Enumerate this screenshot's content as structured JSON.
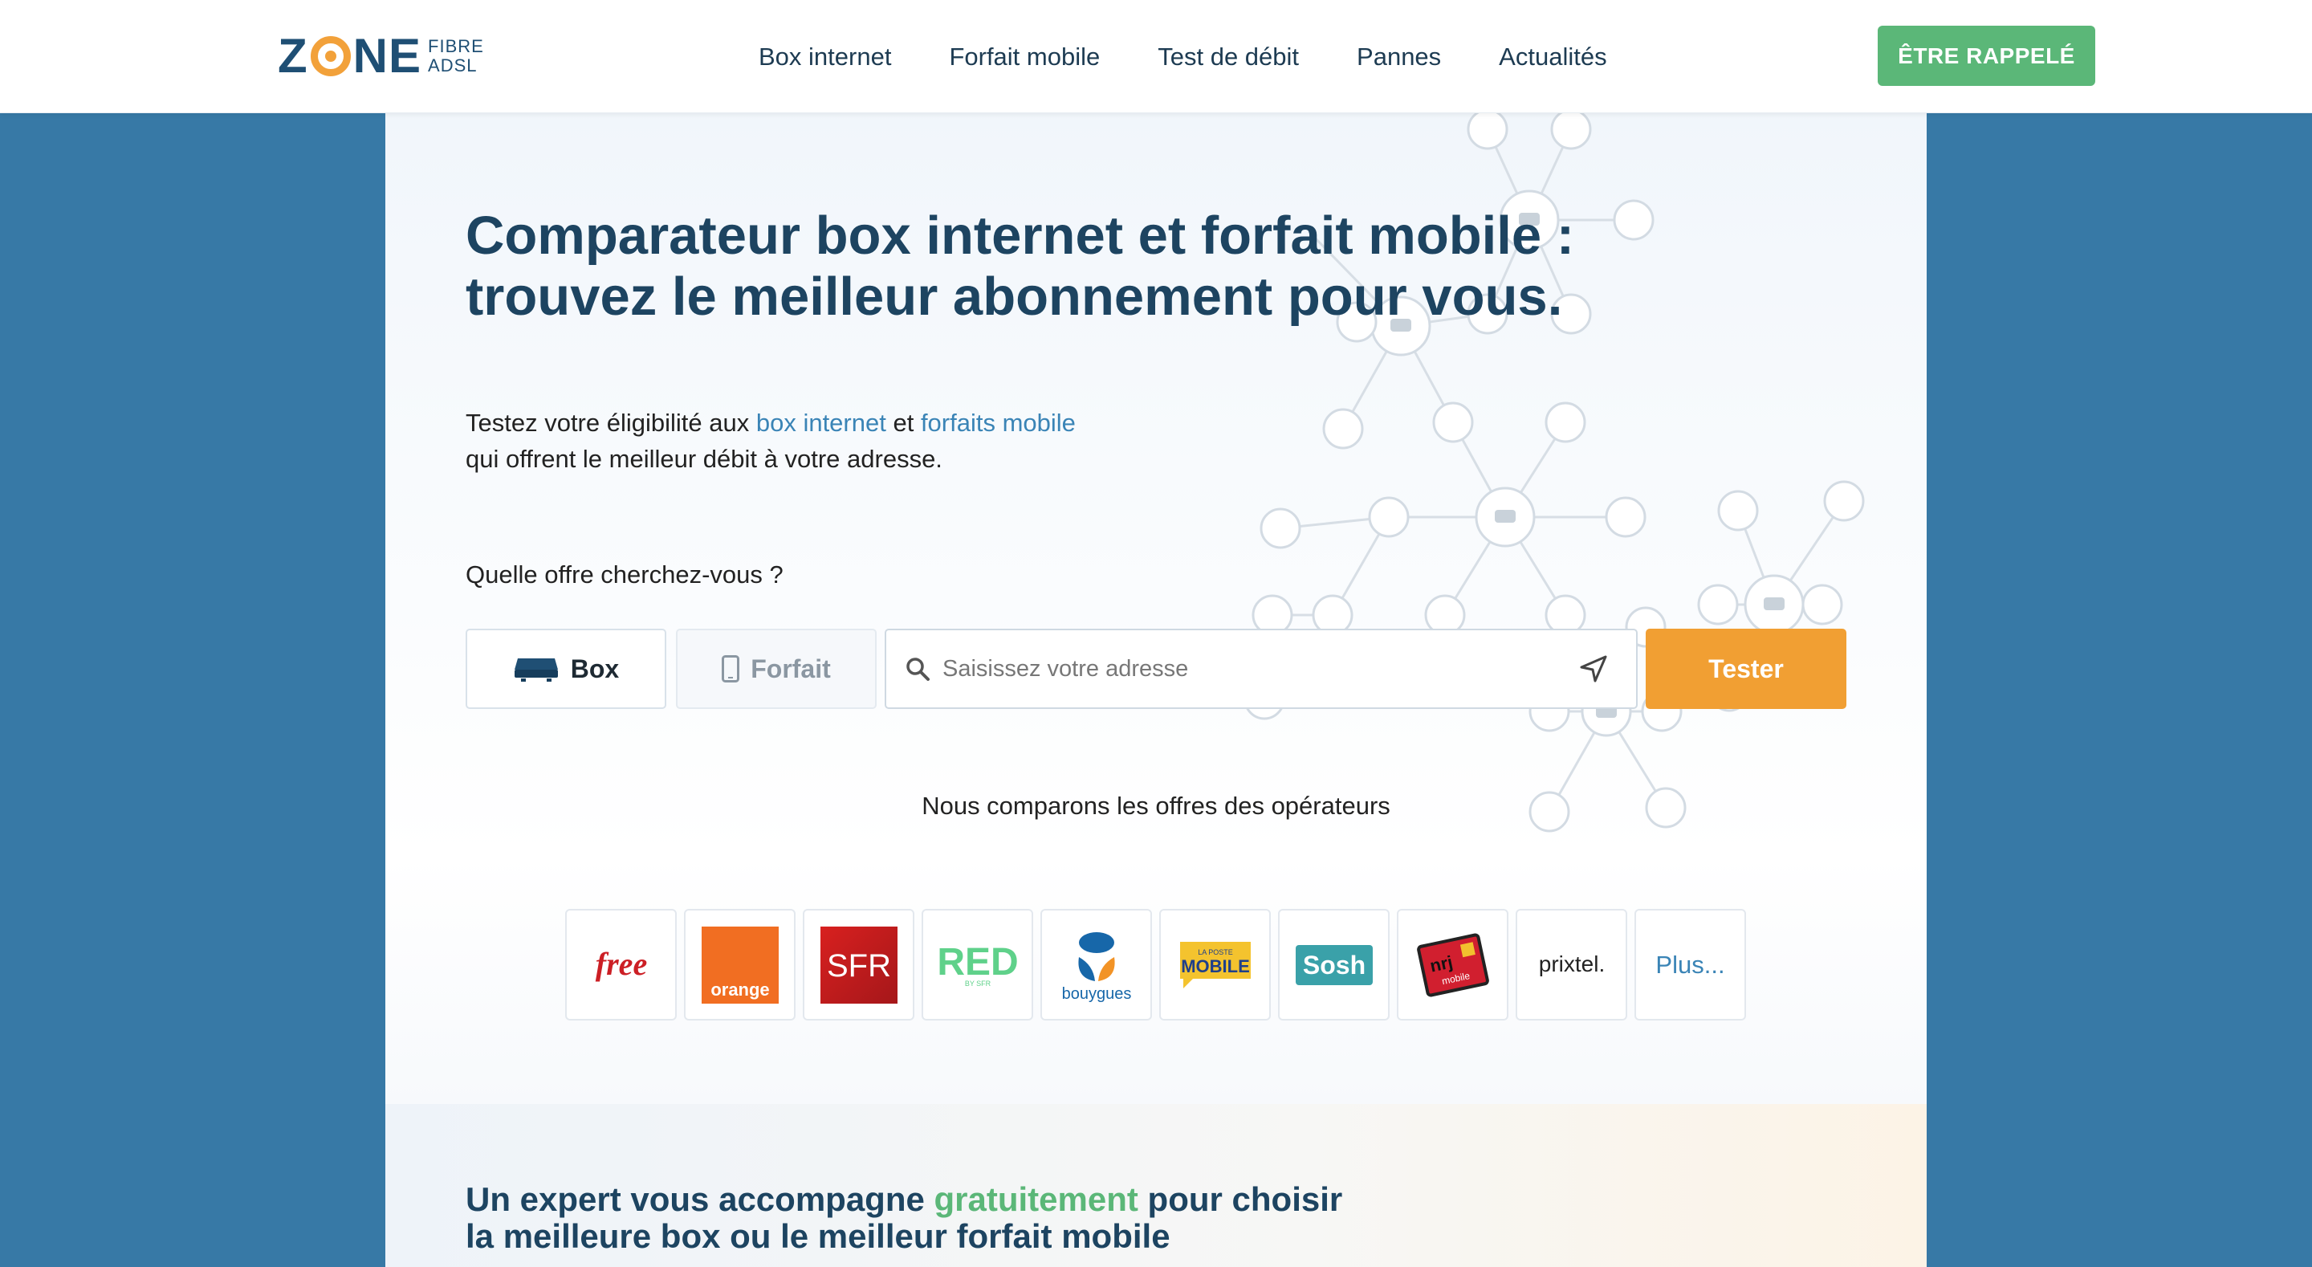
{
  "header": {
    "logo": {
      "main": "ZONE",
      "sub_top": "FIBRE",
      "sub_bottom": "ADSL"
    },
    "nav": [
      "Box internet",
      "Forfait mobile",
      "Test de débit",
      "Pannes",
      "Actualités"
    ],
    "cta": "ÊTRE RAPPELÉ"
  },
  "hero": {
    "title_line1": "Comparateur box internet et forfait mobile :",
    "title_line2": "trouvez le meilleur abonnement pour vous.",
    "intro_pre": "Testez votre éligibilité aux ",
    "intro_link1": "box internet",
    "intro_mid": " et ",
    "intro_link2": "forfaits mobile",
    "intro_line2": "qui offrent le meilleur débit à votre adresse."
  },
  "search": {
    "question": "Quelle offre cherchez-vous ?",
    "tab_box": "Box",
    "tab_forfait": "Forfait",
    "selected_tab": "Box",
    "address_placeholder": "Saisissez votre adresse",
    "submit": "Tester"
  },
  "operators": {
    "label": "Nous comparons les offres des opérateurs",
    "free": "free",
    "orange": "orange",
    "sfr": "SFR",
    "red": "RED",
    "red_sub": "BY SFR",
    "bouygues": "bouygues",
    "laposte_top": "LA POSTE",
    "laposte_main": "MOBILE",
    "sosh": "Sosh",
    "nrj": "nrj",
    "nrj_sub": "mobile",
    "prixtel": "prixtel.",
    "more": "Plus..."
  },
  "expert": {
    "pre": "Un expert vous accompagne ",
    "highlight": "gratuitement",
    "post": " pour choisir",
    "line2": "la meilleure box ou le meilleur forfait mobile"
  },
  "colors": {
    "page_bg": "#3779a6",
    "primary_dark": "#1d4461",
    "green": "#5bb778",
    "orange": "#f19f33",
    "link": "#3a84b6"
  }
}
